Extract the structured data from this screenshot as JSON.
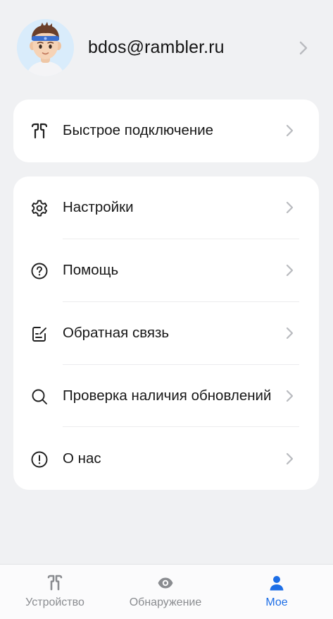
{
  "profile": {
    "email": "bdos@rambler.ru"
  },
  "quick": {
    "label": "Быстрое подключение",
    "icon": "earbuds-icon"
  },
  "menu": {
    "items": [
      {
        "label": "Настройки",
        "icon": "gear-icon"
      },
      {
        "label": "Помощь",
        "icon": "help-icon"
      },
      {
        "label": "Обратная связь",
        "icon": "feedback-icon"
      },
      {
        "label": "Проверка наличия обновлений",
        "icon": "search-icon"
      },
      {
        "label": "О нас",
        "icon": "info-icon"
      }
    ]
  },
  "tabbar": {
    "tabs": [
      {
        "label": "Устройство",
        "icon": "earbuds-icon",
        "active": false
      },
      {
        "label": "Обнаружение",
        "icon": "eye-icon",
        "active": false
      },
      {
        "label": "Мое",
        "icon": "person-icon",
        "active": true
      }
    ]
  },
  "colors": {
    "accent": "#1d6ee6",
    "background": "#f0f1f3",
    "card": "#ffffff",
    "inactive": "#8a8c90"
  }
}
